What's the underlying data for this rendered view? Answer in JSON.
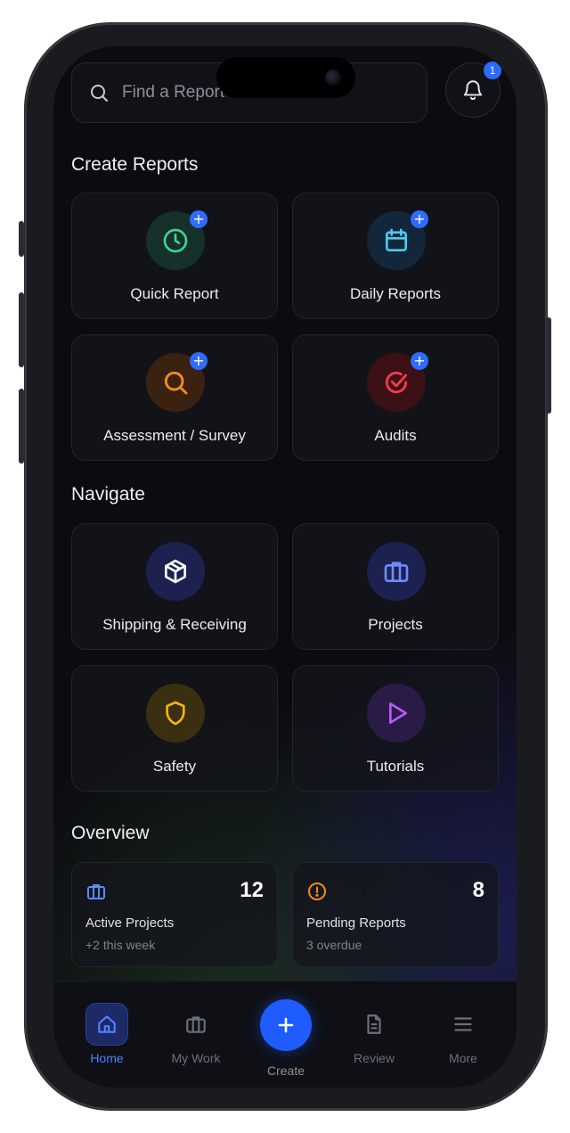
{
  "search": {
    "placeholder": "Find a Report"
  },
  "notifications": {
    "count": "1"
  },
  "sections": {
    "create": "Create Reports",
    "navigate": "Navigate",
    "overview": "Overview"
  },
  "create_tiles": [
    {
      "label": "Quick Report",
      "icon": "clock-icon",
      "color": "#3fd48e"
    },
    {
      "label": "Daily Reports",
      "icon": "calendar-icon",
      "color": "#4cc9f0"
    },
    {
      "label": "Assessment / Survey",
      "icon": "search-icon",
      "color": "#f08a24"
    },
    {
      "label": "Audits",
      "icon": "check-circle-icon",
      "color": "#ef3a4b"
    }
  ],
  "navigate_tiles": [
    {
      "label": "Shipping & Receiving",
      "icon": "box-icon",
      "color": "#ffffff"
    },
    {
      "label": "Projects",
      "icon": "briefcase-icon",
      "color": "#6f8bff"
    },
    {
      "label": "Safety",
      "icon": "shield-icon",
      "color": "#f5b70a"
    },
    {
      "label": "Tutorials",
      "icon": "play-icon",
      "color": "#b35cff"
    }
  ],
  "overview": [
    {
      "title": "Active Projects",
      "value": "12",
      "sub": "+2 this week",
      "icon": "briefcase-icon",
      "color": "#5b8bff"
    },
    {
      "title": "Pending Reports",
      "value": "8",
      "sub": "3 overdue",
      "icon": "alert-icon",
      "color": "#f08a24"
    }
  ],
  "nav": {
    "home": "Home",
    "my_work": "My Work",
    "create": "Create",
    "review": "Review",
    "more": "More"
  },
  "colors": {
    "accent": "#2f6bff",
    "background": "#0b0c10"
  }
}
